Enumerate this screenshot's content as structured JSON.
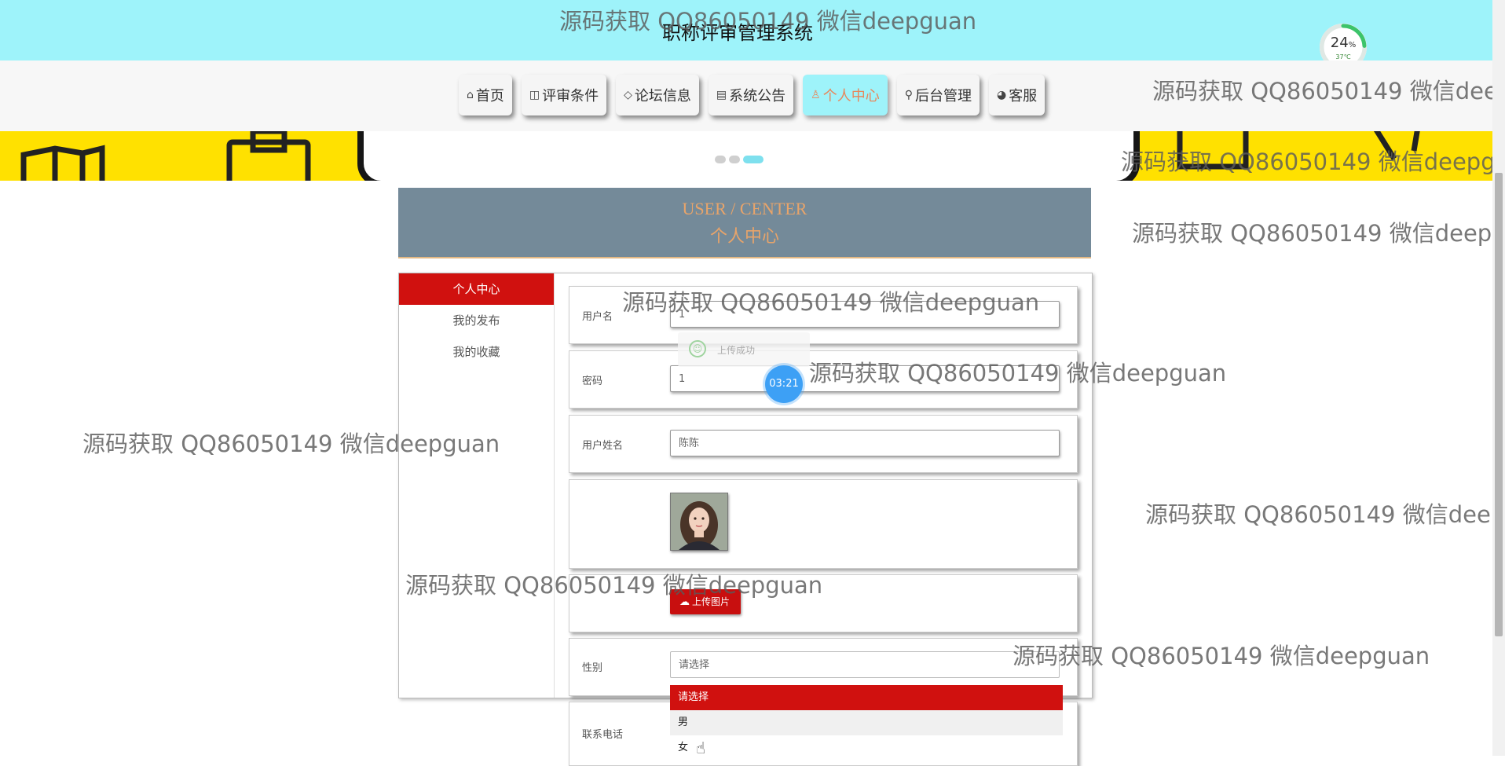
{
  "header": {
    "site_title": "职称评审管理系统"
  },
  "gauge": {
    "value": "24",
    "unit": "%",
    "temperature": "37℃",
    "progress": 0.24
  },
  "nav": {
    "items": [
      {
        "icon": "home-icon",
        "glyph": "⌂",
        "label": "首页"
      },
      {
        "icon": "glasses-icon",
        "glyph": "◫",
        "label": "评审条件"
      },
      {
        "icon": "tag-icon",
        "glyph": "◇",
        "label": "论坛信息"
      },
      {
        "icon": "document-icon",
        "glyph": "▤",
        "label": "系统公告"
      },
      {
        "icon": "user-icon",
        "glyph": "♙",
        "label": "个人中心"
      },
      {
        "icon": "link-icon",
        "glyph": "⚲",
        "label": "后台管理"
      },
      {
        "icon": "chat-icon",
        "glyph": "◕",
        "label": "客服"
      }
    ],
    "active": "个人中心"
  },
  "user_center": {
    "title_en": "USER / CENTER",
    "title_zh": "个人中心"
  },
  "side_menu": {
    "items": [
      "个人中心",
      "我的发布",
      "我的收藏"
    ]
  },
  "form": {
    "username_label": "用户名",
    "username_value": "1",
    "password_label": "密码",
    "password_value": "1",
    "realname_label": "用户姓名",
    "realname_value": "陈陈",
    "upload_label": "上传图片",
    "gender_label": "性别",
    "gender_placeholder": "请选择",
    "phone_label": "联系电话"
  },
  "gender_dropdown": {
    "options": [
      "请选择",
      "男",
      "女"
    ],
    "selected": "请选择"
  },
  "toast": {
    "text": "上传成功"
  },
  "timer": {
    "text": "03:21"
  },
  "watermark": {
    "text": "源码获取 QQ86050149 微信deepguan"
  },
  "colors": {
    "top_bar": "#9ef3fa",
    "accent_red": "#d0110f",
    "header_slate": "#748a99",
    "header_text": "#e8a46a",
    "banner_yellow": "#ffe100"
  }
}
